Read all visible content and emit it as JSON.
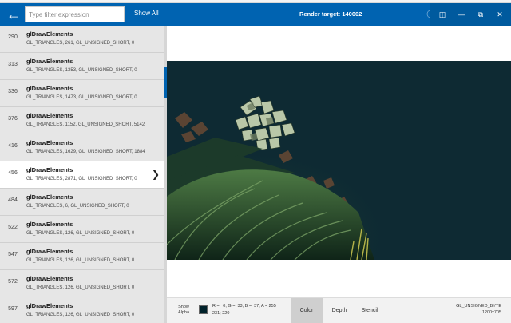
{
  "header": {
    "back_icon": "arrow-left-icon",
    "filter_placeholder": "Type filter expression",
    "show_all": "Show All",
    "render_target": "Render target: 140002"
  },
  "calls": [
    {
      "num": "290",
      "fn": "glDrawElements",
      "args": "GL_TRIANGLES, 261, GL_UNSIGNED_SHORT, 0"
    },
    {
      "num": "313",
      "fn": "glDrawElements",
      "args": "GL_TRIANGLES, 1353, GL_UNSIGNED_SHORT, 0"
    },
    {
      "num": "336",
      "fn": "glDrawElements",
      "args": "GL_TRIANGLES, 1473, GL_UNSIGNED_SHORT, 0"
    },
    {
      "num": "376",
      "fn": "glDrawElements",
      "args": "GL_TRIANGLES, 1152, GL_UNSIGNED_SHORT, 5142"
    },
    {
      "num": "416",
      "fn": "glDrawElements",
      "args": "GL_TRIANGLES, 1629, GL_UNSIGNED_SHORT, 1884"
    },
    {
      "num": "456",
      "fn": "glDrawElements",
      "args": "GL_TRIANGLES, 2871, GL_UNSIGNED_SHORT, 0"
    },
    {
      "num": "484",
      "fn": "glDrawElements",
      "args": "GL_TRIANGLES, 6, GL_UNSIGNED_SHORT, 0"
    },
    {
      "num": "522",
      "fn": "glDrawElements",
      "args": "GL_TRIANGLES, 126, GL_UNSIGNED_SHORT, 0"
    },
    {
      "num": "547",
      "fn": "glDrawElements",
      "args": "GL_TRIANGLES, 126, GL_UNSIGNED_SHORT, 0"
    },
    {
      "num": "572",
      "fn": "glDrawElements",
      "args": "GL_TRIANGLES, 126, GL_UNSIGNED_SHORT, 0"
    },
    {
      "num": "597",
      "fn": "glDrawElements",
      "args": "GL_TRIANGLES, 126, GL_UNSIGNED_SHORT, 0"
    }
  ],
  "selected_call": "456",
  "bottom": {
    "show_alpha": "Show Alpha",
    "pixel_color_hex": "#00212A",
    "pixel_value": "R =   0, G =  33, B =  37, A = 255",
    "pixel_coord": "231; 220",
    "tabs": [
      "Color",
      "Depth",
      "Stencil"
    ],
    "active_tab": "Color",
    "format": "GL_UNSIGNED_BYTE",
    "resolution": "1200x705"
  },
  "colors": {
    "accent": "#0063B1",
    "render_background": "#0E2A33"
  }
}
